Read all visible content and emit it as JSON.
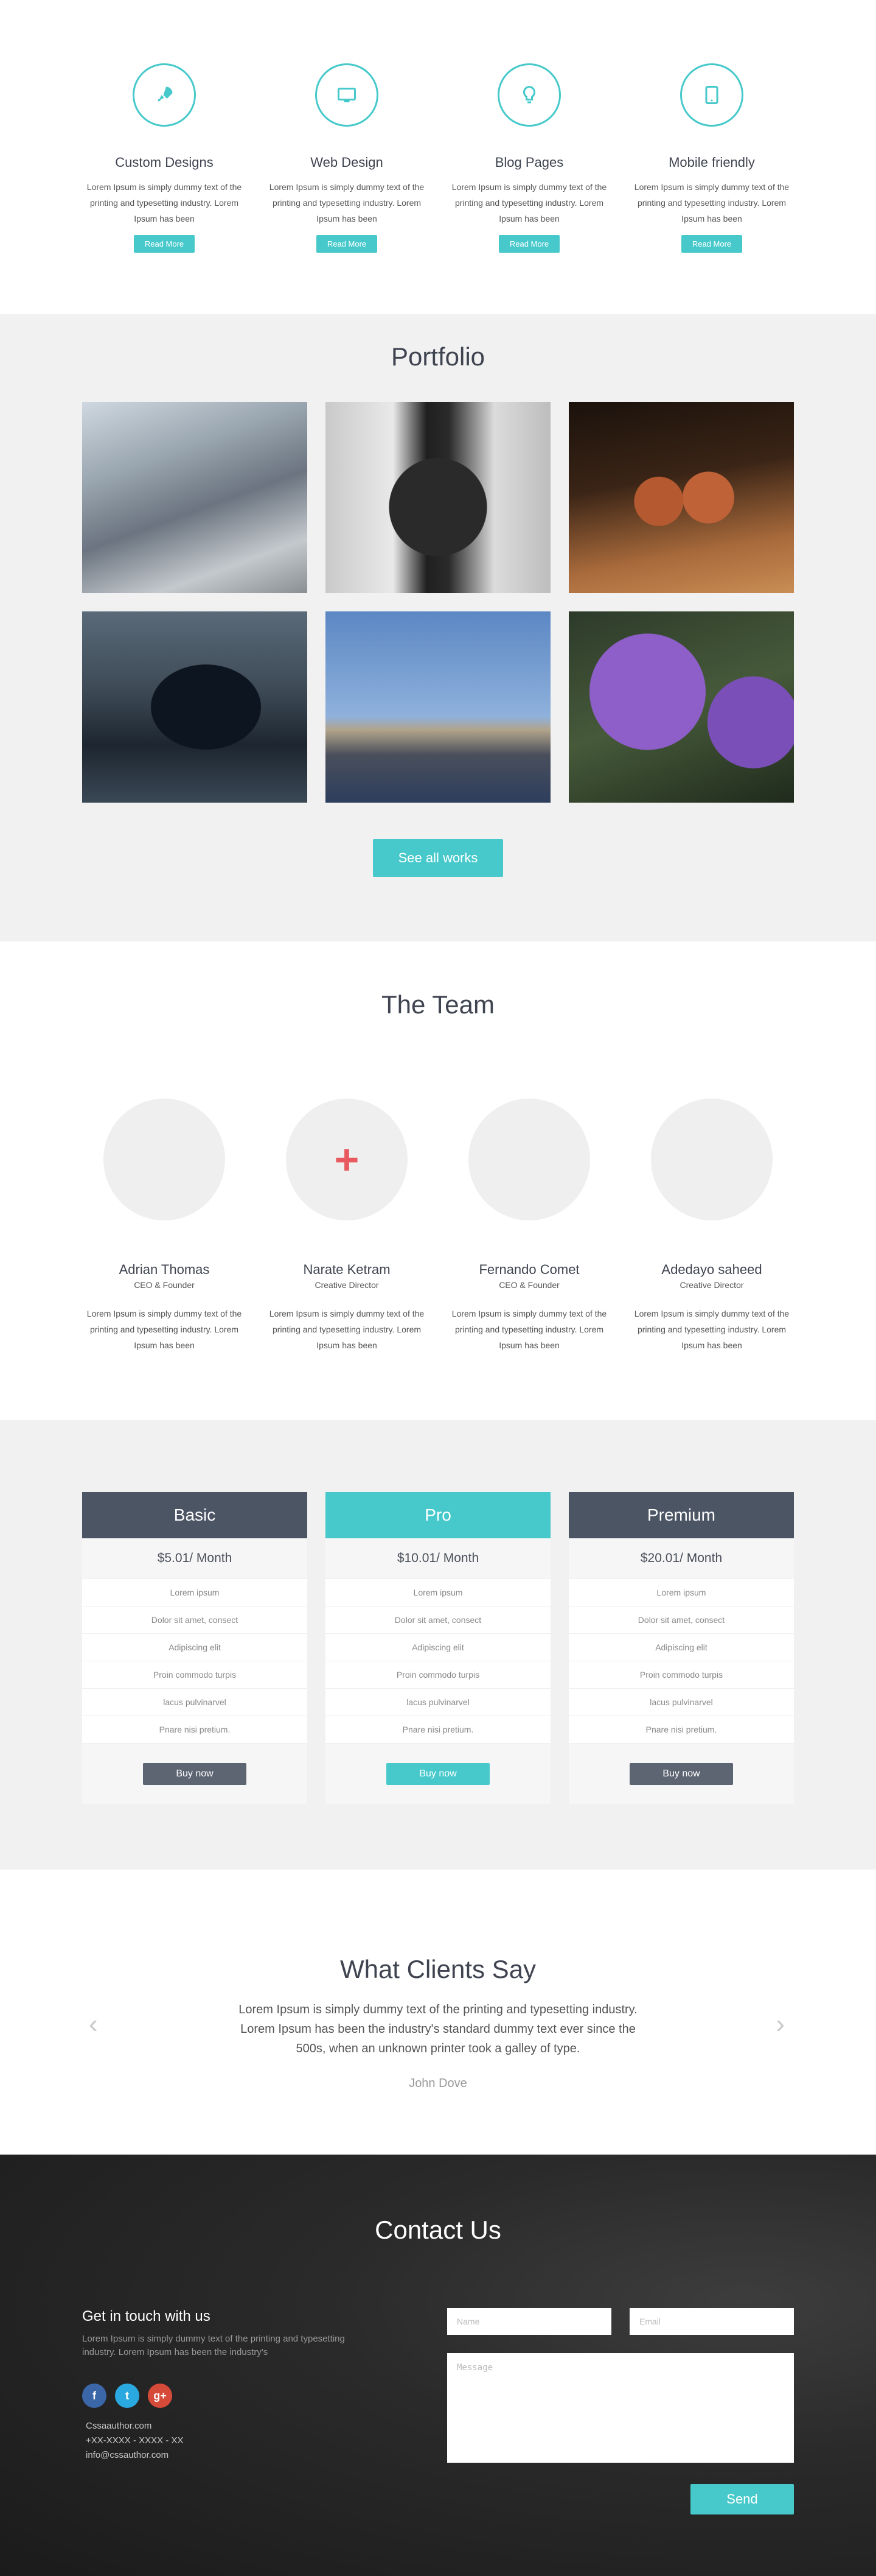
{
  "services": [
    {
      "icon": "rocket-icon",
      "title": "Custom Designs",
      "text": "Lorem Ipsum is simply dummy text of the printing and typesetting industry. Lorem Ipsum has been",
      "button": "Read More"
    },
    {
      "icon": "monitor-icon",
      "title": "Web Design",
      "text": "Lorem Ipsum is simply dummy text of the printing and typesetting industry. Lorem Ipsum has been",
      "button": "Read More"
    },
    {
      "icon": "lightbulb-icon",
      "title": "Blog Pages",
      "text": "Lorem Ipsum is simply dummy text of the printing and typesetting industry. Lorem Ipsum has been",
      "button": "Read More"
    },
    {
      "icon": "tablet-icon",
      "title": "Mobile friendly",
      "text": "Lorem Ipsum is simply dummy text of the printing and typesetting industry. Lorem Ipsum has been",
      "button": "Read More"
    }
  ],
  "portfolio": {
    "title": "Portfolio",
    "images": [
      "mountains",
      "camera",
      "nuts",
      "gamepad",
      "city-skyline",
      "purple-flowers"
    ],
    "cta": "See all works"
  },
  "team": {
    "title": "The Team",
    "members": [
      {
        "name": "Adrian Thomas",
        "role": "CEO & Founder",
        "text": "Lorem Ipsum is simply dummy text of the printing and typesetting industry. Lorem Ipsum has been"
      },
      {
        "name": "Narate Ketram",
        "role": "Creative Director",
        "text": "Lorem Ipsum is simply dummy text of the printing and typesetting industry. Lorem Ipsum has been",
        "avatar_icon": "+"
      },
      {
        "name": "Fernando Comet",
        "role": "CEO & Founder",
        "text": "Lorem Ipsum is simply dummy text of the printing and typesetting industry. Lorem Ipsum has been"
      },
      {
        "name": "Adedayo saheed",
        "role": "Creative Director",
        "text": "Lorem Ipsum is simply dummy text of the printing and typesetting industry. Lorem Ipsum has been"
      }
    ]
  },
  "pricing": {
    "plans": [
      {
        "name": "Basic",
        "price": "$5.01/ Month",
        "features": [
          "Lorem ipsum",
          "Dolor sit amet, consect",
          "Adipiscing elit",
          "Proin commodo turpis",
          "lacus pulvinarvel",
          "Pnare nisi pretium."
        ],
        "button": "Buy now"
      },
      {
        "name": "Pro",
        "price": "$10.01/ Month",
        "features": [
          "Lorem ipsum",
          "Dolor sit amet, consect",
          "Adipiscing elit",
          "Proin commodo turpis",
          "lacus pulvinarvel",
          "Pnare nisi pretium."
        ],
        "button": "Buy now"
      },
      {
        "name": "Premium",
        "price": "$20.01/ Month",
        "features": [
          "Lorem ipsum",
          "Dolor sit amet, consect",
          "Adipiscing elit",
          "Proin commodo turpis",
          "lacus pulvinarvel",
          "Pnare nisi pretium."
        ],
        "button": "Buy now"
      }
    ]
  },
  "clients": {
    "title": "What Clients Say",
    "quote": "Lorem Ipsum is simply dummy text of the printing and typesetting industry. Lorem Ipsum has been the industry's standard dummy text ever since the 500s, when an unknown printer took a galley of type.",
    "author": "John Dove",
    "prev_icon": "‹",
    "next_icon": "›"
  },
  "contact": {
    "title": "Contact Us",
    "heading": "Get in touch with us",
    "text": "Lorem Ipsum is simply dummy text of the printing and typesetting industry. Lorem Ipsum has been the industry's",
    "social": {
      "facebook": "f",
      "twitter": "t",
      "google": "g+"
    },
    "site": "Cssaauthor.com",
    "phone": "+XX-XXXX - XXXX - XX",
    "email": "info@cssauthor.com",
    "name_placeholder": "Name",
    "email_placeholder": "Email",
    "message_placeholder": "Message",
    "send": "Send"
  },
  "colors": {
    "accent": "#47c9cb",
    "dark": "#4c5563",
    "red": "#e85a5f"
  }
}
